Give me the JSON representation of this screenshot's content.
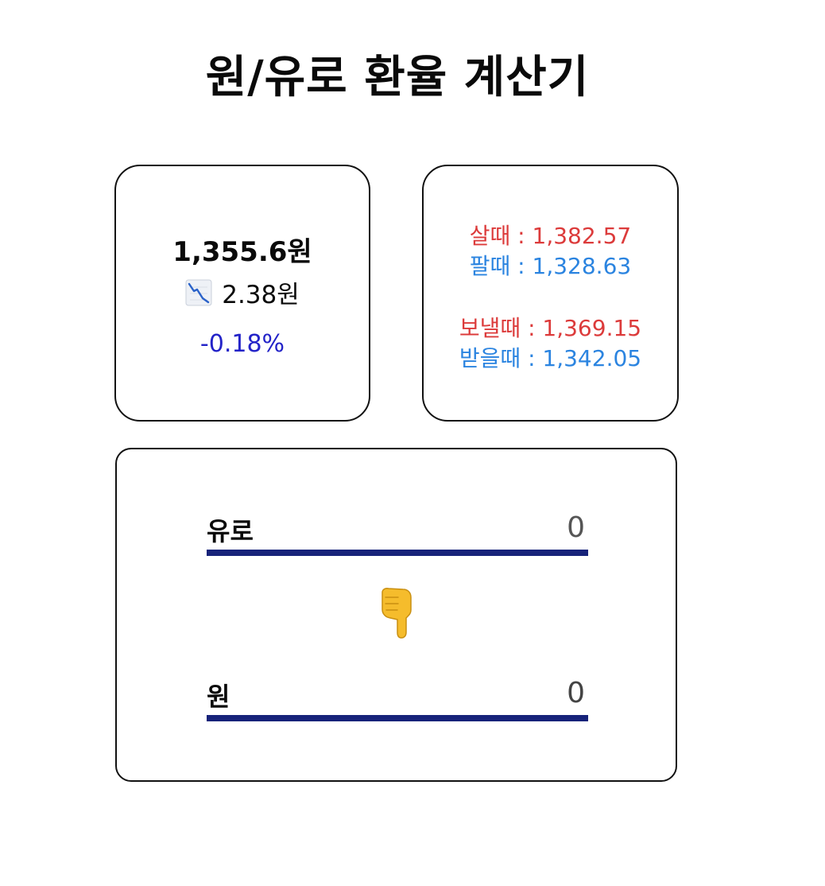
{
  "title": "원/유로 환율 계산기",
  "rate": {
    "current": "1,355.6원",
    "change": "2.38원",
    "change_icon": "chart-decreasing-icon",
    "percent": "-0.18%",
    "colors": {
      "percent": "#2323c8"
    }
  },
  "spread": {
    "buy": "살때 : 1,382.57",
    "sell": "팔때 : 1,328.63",
    "send": "보낼때 : 1,369.15",
    "receive": "받을때 : 1,342.05",
    "colors": {
      "buy": "#dc3b3b",
      "sell": "#2b84e0"
    }
  },
  "calculator": {
    "euro_label": "유로",
    "euro_value": "0",
    "arrow_icon": "pointing-down-hand-icon",
    "won_label": "원",
    "won_value": "0",
    "colors": {
      "underline": "#17237a"
    }
  }
}
